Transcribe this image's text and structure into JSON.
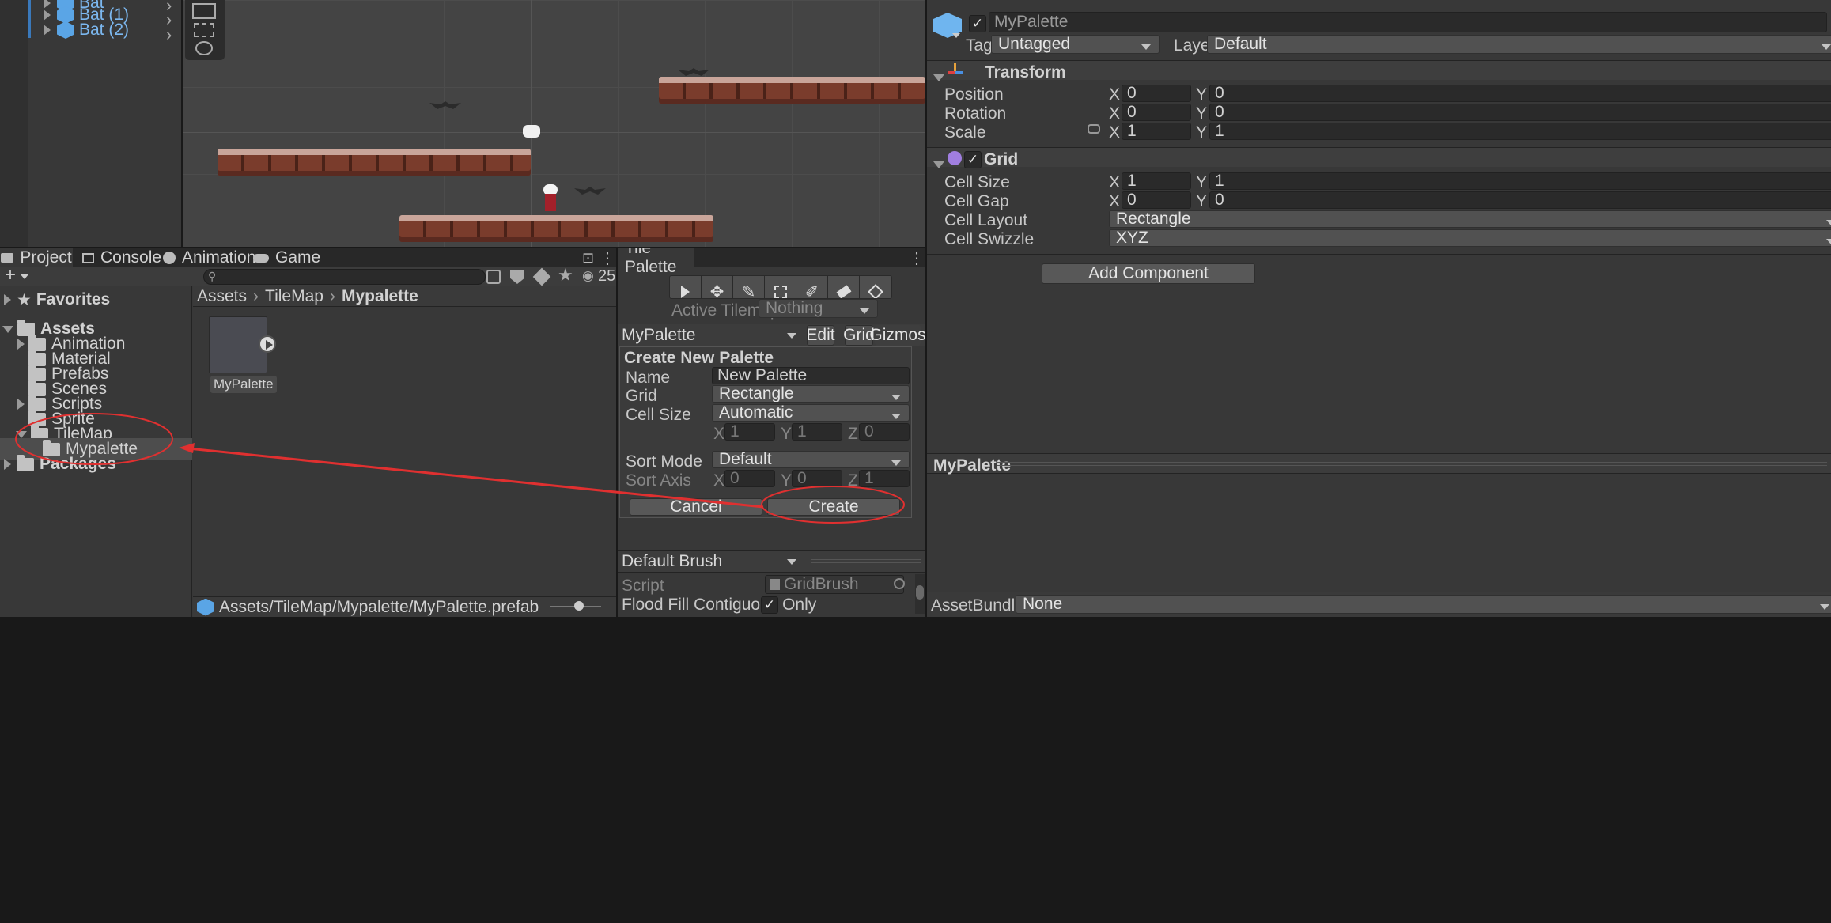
{
  "hierarchy": {
    "items": [
      {
        "label": "Bat"
      },
      {
        "label": "Bat (1)"
      },
      {
        "label": "Bat (2)"
      }
    ]
  },
  "project": {
    "tabs": [
      {
        "label": "Project"
      },
      {
        "label": "Console"
      },
      {
        "label": "Animation"
      },
      {
        "label": "Game"
      }
    ],
    "visible_count": "25",
    "tree": {
      "favorites": "Favorites",
      "assets": "Assets",
      "children": [
        "Animation",
        "Material",
        "Prefabs",
        "Scenes",
        "Scripts",
        "Sprite",
        "TileMap"
      ],
      "selected": "Mypalette",
      "packages": "Packages"
    },
    "breadcrumb": [
      "Assets",
      "TileMap",
      "Mypalette"
    ],
    "asset": {
      "label": "MyPalette"
    },
    "footer_path": "Assets/TileMap/Mypalette/MyPalette.prefab"
  },
  "tile_palette": {
    "title": "Tile Palette",
    "active_tilemap_label": "Active Tilemap",
    "active_tilemap_value": "Nothing",
    "palette_select": "MyPalette",
    "edit": "Edit",
    "grid": "Grid",
    "gizmos": "Gizmos",
    "create": {
      "title": "Create New Palette",
      "name_label": "Name",
      "name_value": "New Palette",
      "grid_label": "Grid",
      "grid_value": "Rectangle",
      "cell_size_label": "Cell Size",
      "cell_size_value": "Automatic",
      "x": "X",
      "y": "Y",
      "z": "Z",
      "cell_x": "1",
      "cell_y": "1",
      "cell_z": "0",
      "sort_mode_label": "Sort Mode",
      "sort_mode_value": "Default",
      "sort_axis_label": "Sort Axis",
      "axis_x": "0",
      "axis_y": "0",
      "axis_z": "1",
      "cancel": "Cancel",
      "create": "Create"
    },
    "brush_select": "Default Brush",
    "script_label": "Script",
    "script_value": "GridBrush",
    "flood_label": "Flood Fill Contiguous Only"
  },
  "inspector": {
    "object_name": "MyPalette",
    "tag_label": "Tag",
    "tag_value": "Untagged",
    "layer_label": "Layer",
    "layer_value": "Default",
    "transform": {
      "title": "Transform",
      "position": "Position",
      "rotation": "Rotation",
      "scale": "Scale",
      "pos_x": "0",
      "pos_y": "0",
      "rot_x": "0",
      "rot_y": "0",
      "scale_x": "1",
      "scale_y": "1"
    },
    "grid": {
      "title": "Grid",
      "cell_size": "Cell Size",
      "cell_gap": "Cell Gap",
      "cell_layout": "Cell Layout",
      "cell_swizzle": "Cell Swizzle",
      "size_x": "1",
      "size_y": "1",
      "gap_x": "0",
      "gap_y": "0",
      "layout_value": "Rectangle",
      "swizzle_value": "XYZ"
    },
    "add_component": "Add Component",
    "preview_title": "MyPalette",
    "assetbundle_label": "AssetBundle",
    "assetbundle_value": "None"
  },
  "colors": {
    "annotation": "#e03030",
    "accent": "#3a79bb",
    "panel": "#383838"
  }
}
